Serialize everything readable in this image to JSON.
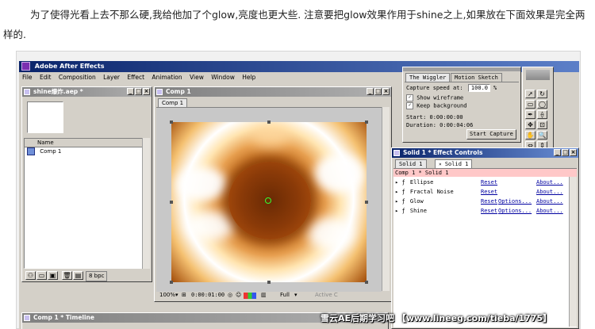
{
  "intro_text": "为了使得光看上去不那么硬,我给他加了个glow,亮度也更大些. 注意要把glow效果作用于shine之上,如果放在下面效果是完全两样的.",
  "app": {
    "title": "Adobe After Effects",
    "menu": [
      "File",
      "Edit",
      "Composition",
      "Layer",
      "Effect",
      "Animation",
      "View",
      "Window",
      "Help"
    ]
  },
  "project_window": {
    "title": "shine爆炸.aep *",
    "column_name": "Name",
    "items": [
      {
        "label": "Comp 1"
      }
    ],
    "bit_depth": "8 bpc"
  },
  "comp_window": {
    "title": "Comp 1",
    "tab": "Comp 1",
    "zoom": "100%",
    "timecode": "0:00:01:00",
    "resolution": "Full",
    "camera": "Active C"
  },
  "wiggler_window": {
    "tabs": [
      "The Wiggler",
      "Motion Sketch"
    ],
    "capture_speed_label": "Capture speed at:",
    "capture_speed_value": "100.0",
    "capture_speed_unit": "%",
    "show_wireframe": "Show wireframe",
    "keep_background": "Keep background",
    "start": "Start: 0:00:00:00",
    "duration": "Duration: 0:00:04:06",
    "start_capture": "Start Capture"
  },
  "effect_controls": {
    "title": "Solid 1 * Effect Controls",
    "tabs": [
      "Solid 1",
      "Solid 1"
    ],
    "header": "Comp 1 * Solid 1",
    "effects": [
      {
        "name": "Ellipse",
        "reset": "Reset",
        "options": "",
        "about": "About..."
      },
      {
        "name": "Fractal Noise",
        "reset": "Reset",
        "options": "",
        "about": "About..."
      },
      {
        "name": "Glow",
        "reset": "Reset",
        "options": "Options...",
        "about": "About..."
      },
      {
        "name": "Shine",
        "reset": "Reset",
        "options": "Options...",
        "about": "About..."
      }
    ]
  },
  "timeline": {
    "title": "Comp 1 * Timeline"
  },
  "watermark": "雪云AE后期学习吧 【www.lineeg.com/tieba/1775】",
  "colors": {
    "title_active": "#0a246a",
    "panel": "#d4d0c8",
    "effects_header": "#ffc8c8",
    "link": "#0000a0",
    "glow_core": "#ffffff",
    "glow_mid": "#d07010",
    "glow_dark": "#3a1400"
  }
}
